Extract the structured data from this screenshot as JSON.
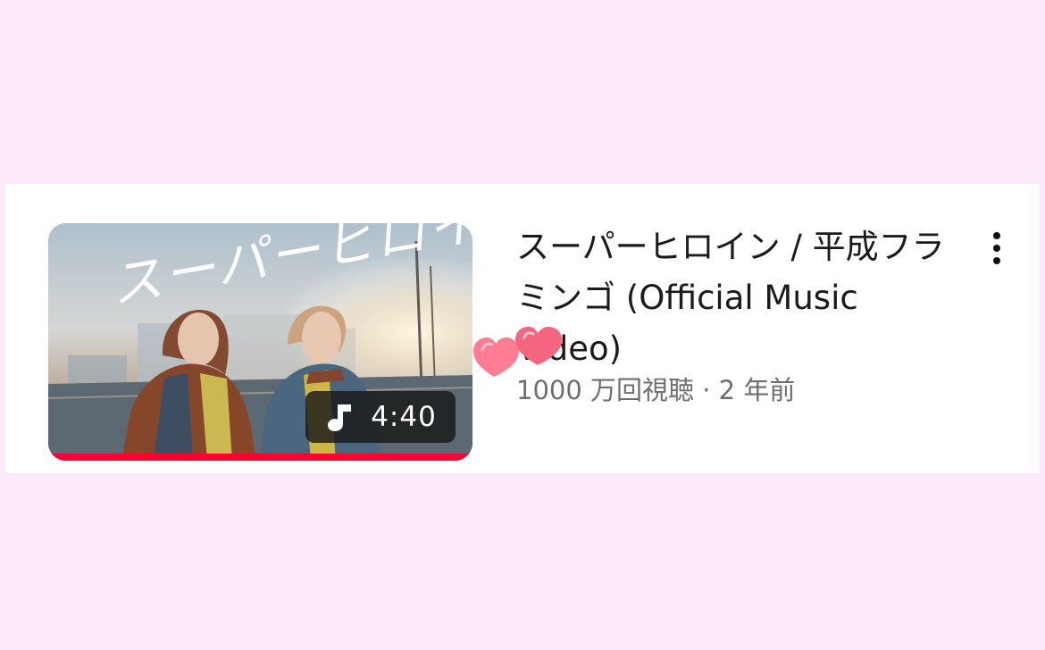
{
  "video": {
    "thumbnail_title": "スーパーヒロイン",
    "duration": "4:40",
    "title": "スーパーヒロイン / 平成フラミンゴ (Official Music Video)",
    "meta": "1000 万回視聴 · 2 年前",
    "watch_progress_percent": 100
  },
  "icons": {
    "duration": "music-note-icon",
    "menu": "more-vertical-icon",
    "sticker": "hearts-sticker"
  },
  "colors": {
    "background": "#fce9fa",
    "progress": "#ff0033",
    "title": "#1b1b1b",
    "meta": "#6f6f6f",
    "heart": "#ff7c93"
  }
}
